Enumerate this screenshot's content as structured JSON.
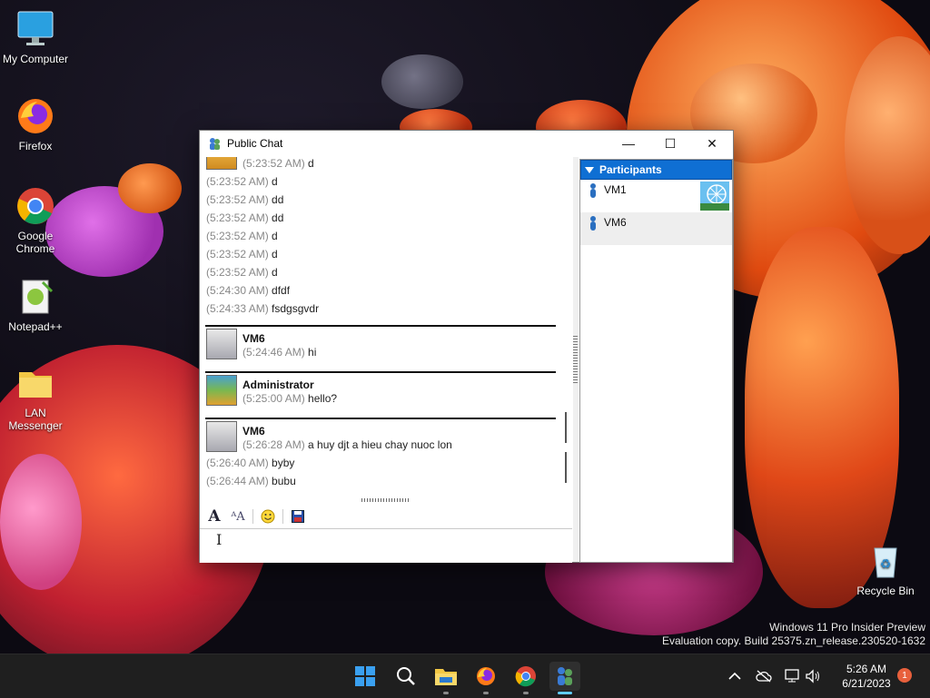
{
  "desktop": {
    "icons": [
      {
        "label": "My Computer"
      },
      {
        "label": "Firefox"
      },
      {
        "label": "Google Chrome"
      },
      {
        "label": "Notepad++"
      },
      {
        "label": "LAN Messenger"
      },
      {
        "label": "Recycle Bin"
      }
    ],
    "watermark": {
      "line1": "Windows 11 Pro Insider Preview",
      "line2": "Evaluation copy. Build 25375.zn_release.230520-1632"
    }
  },
  "chat_window": {
    "title": "Public Chat",
    "controls": {
      "minimize": "—",
      "maximize": "☐",
      "close": "✕"
    },
    "messages_top": [
      {
        "time": "(5:23:52 AM)",
        "text": "d"
      },
      {
        "time": "(5:23:52 AM)",
        "text": "d"
      },
      {
        "time": "(5:23:52 AM)",
        "text": "dd"
      },
      {
        "time": "(5:23:52 AM)",
        "text": "dd"
      },
      {
        "time": "(5:23:52 AM)",
        "text": "d"
      },
      {
        "time": "(5:23:52 AM)",
        "text": "d"
      },
      {
        "time": "(5:23:52 AM)",
        "text": "d"
      },
      {
        "time": "(5:24:30 AM)",
        "text": "dfdf"
      },
      {
        "time": "(5:24:33 AM)",
        "text": "fsdgsgvdr"
      }
    ],
    "groups": [
      {
        "sender": "VM6",
        "lines": [
          {
            "time": "(5:24:46 AM)",
            "text": "hi"
          }
        ]
      },
      {
        "sender": "Administrator",
        "lines": [
          {
            "time": "(5:25:00 AM)",
            "text": "hello?"
          }
        ]
      },
      {
        "sender": "VM6",
        "lines": [
          {
            "time": "(5:26:28 AM)",
            "text": "a huy djt a hieu chay nuoc lon"
          },
          {
            "time": "(5:26:40 AM)",
            "text": "byby"
          },
          {
            "time": "(5:26:44 AM)",
            "text": "bubu"
          }
        ]
      }
    ],
    "participants": {
      "header": "Participants",
      "items": [
        {
          "name": "VM1"
        },
        {
          "name": "VM6"
        }
      ]
    }
  },
  "taskbar": {
    "clock_time": "5:26 AM",
    "clock_date": "6/21/2023",
    "notification_count": "1",
    "apps": [
      "start-icon",
      "search-icon",
      "file-explorer-icon",
      "firefox-icon",
      "chrome-icon",
      "lan-messenger-icon"
    ]
  }
}
